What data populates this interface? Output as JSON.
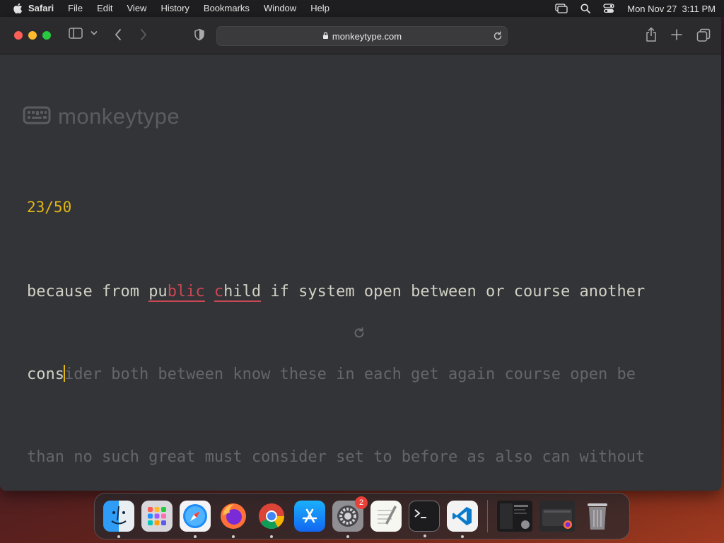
{
  "menubar": {
    "app_name": "Safari",
    "items": [
      "File",
      "Edit",
      "View",
      "History",
      "Bookmarks",
      "Window",
      "Help"
    ],
    "datetime": "Mon Nov 27  3:11 PM"
  },
  "browser": {
    "url": "monkeytype.com"
  },
  "page": {
    "logo_text": "monkeytype",
    "counter": "23/50",
    "line1": {
      "w1": "because from ",
      "w2a": "pu",
      "w2b": "blic",
      "w3a": "c",
      "w3b": "hild",
      "rest": " if system open between or course another"
    },
    "line2": {
      "typed": "cons",
      "untyped": "ider both between know these in each get again course open be"
    },
    "line3": "than no such great must consider set to before as also can without"
  },
  "dock": {
    "apps": [
      "finder-icon",
      "launchpad-icon",
      "safari-icon",
      "firefox-icon",
      "chrome-icon",
      "app-store-icon",
      "system-settings-icon",
      "textedit-icon",
      "terminal-icon",
      "vscode-icon"
    ],
    "settings_badge": "2"
  },
  "colors": {
    "bg": "#323437",
    "main": "#e2b714",
    "text": "#d1d0c5",
    "sub": "#646669",
    "error": "#ca4754"
  }
}
